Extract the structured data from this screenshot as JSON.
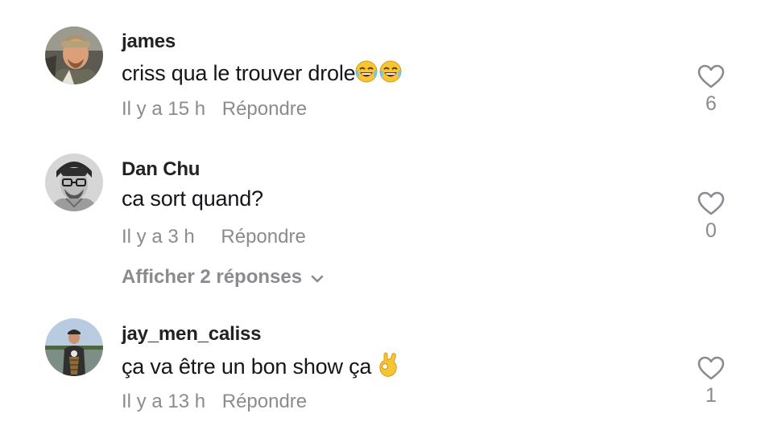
{
  "comments": [
    {
      "username": "james",
      "text": "criss qua le trouver drole",
      "emoji": "😂😂",
      "emoji_icon": "laughing-tears-emoji-icon",
      "time": "Il y a 15 h",
      "reply_label": "Répondre",
      "likes": "6"
    },
    {
      "username": "Dan Chu",
      "text": "ca sort quand?",
      "time": "Il y a 3 h",
      "reply_label": "Répondre",
      "likes": "0",
      "show_replies_label": "Afficher 2 réponses"
    },
    {
      "username": "jay_men_caliss",
      "text": "ça va être un bon show ça ",
      "emoji": "👌",
      "emoji_icon": "ok-hand-emoji-icon",
      "time": "Il y a 13 h",
      "reply_label": "Répondre",
      "likes": "1"
    }
  ],
  "colors": {
    "text": "#16161a",
    "muted": "#8a8b91",
    "background": "#ffffff"
  }
}
